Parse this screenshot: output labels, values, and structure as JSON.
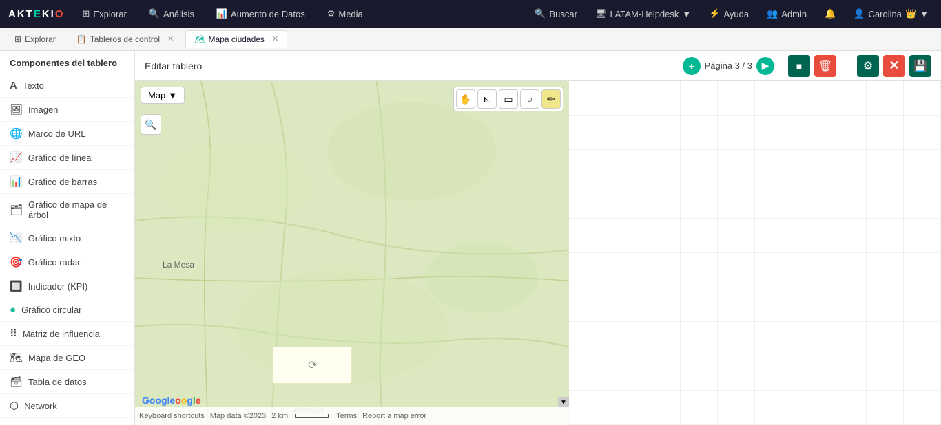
{
  "app": {
    "logo_text": "AKTEKIO",
    "logo_highlight": "O"
  },
  "topnav": {
    "items": [
      {
        "id": "explorar",
        "label": "Explorar",
        "icon": "⊞"
      },
      {
        "id": "analisis",
        "label": "Análisis",
        "icon": "🔍"
      },
      {
        "id": "aumento",
        "label": "Aumento de Datos",
        "icon": "📊"
      },
      {
        "id": "media",
        "label": "Media",
        "icon": "⚙"
      }
    ],
    "right": {
      "search": "Buscar",
      "helpdesk": "LATAM-Helpdesk",
      "ayuda": "Ayuda",
      "admin": "Admin",
      "user": "Carolina"
    }
  },
  "tabs": [
    {
      "id": "explorar",
      "label": "Explorar",
      "icon": "⊞",
      "closeable": false,
      "active": false
    },
    {
      "id": "tableros",
      "label": "Tableros de control",
      "icon": "📋",
      "closeable": true,
      "active": false
    },
    {
      "id": "mapa",
      "label": "Mapa ciudades",
      "icon": "🗺",
      "closeable": true,
      "active": true
    }
  ],
  "edit_toolbar": {
    "title": "Editar tablero",
    "page_label": "Página 3 / 3",
    "save_icon": "💾",
    "delete_icon": "🗑",
    "share_icon": "⚙",
    "close_icon": "✕",
    "disk_icon": "💾"
  },
  "sidebar": {
    "title": "Componentes del tablero",
    "items": [
      {
        "id": "texto",
        "label": "Texto",
        "icon": "A"
      },
      {
        "id": "imagen",
        "label": "Imagen",
        "icon": "🖼"
      },
      {
        "id": "marco-url",
        "label": "Marco de URL",
        "icon": "🌐"
      },
      {
        "id": "grafico-linea",
        "label": "Gráfico de línea",
        "icon": "📈"
      },
      {
        "id": "grafico-barras",
        "label": "Gráfico de barras",
        "icon": "📊"
      },
      {
        "id": "grafico-arbol",
        "label": "Gráfico de mapa de árbol",
        "icon": "🗂"
      },
      {
        "id": "grafico-mixto",
        "label": "Gráfico mixto",
        "icon": "📉"
      },
      {
        "id": "grafico-radar",
        "label": "Gráfico radar",
        "icon": "🎯"
      },
      {
        "id": "indicador-kpi",
        "label": "Indicador (KPI)",
        "icon": "🔲"
      },
      {
        "id": "grafico-circular",
        "label": "Gráfico circular",
        "icon": "🟢"
      },
      {
        "id": "matriz-influencia",
        "label": "Matriz de influencia",
        "icon": "⠿"
      },
      {
        "id": "mapa-geo",
        "label": "Mapa de GEO",
        "icon": "🗺"
      },
      {
        "id": "tabla-datos",
        "label": "Tabla de datos",
        "icon": "🗃"
      },
      {
        "id": "network",
        "label": "Network",
        "icon": "⬡"
      }
    ]
  },
  "map": {
    "type_btn": "Map",
    "location_label": "La Mesa",
    "location_label2": "Altamira",
    "google_label": "Google",
    "bottom_bar": {
      "keyboard": "Keyboard shortcuts",
      "map_data": "Map data ©2023",
      "scale": "2 km",
      "terms": "Terms",
      "report": "Report a map error"
    },
    "loading_text": ""
  }
}
